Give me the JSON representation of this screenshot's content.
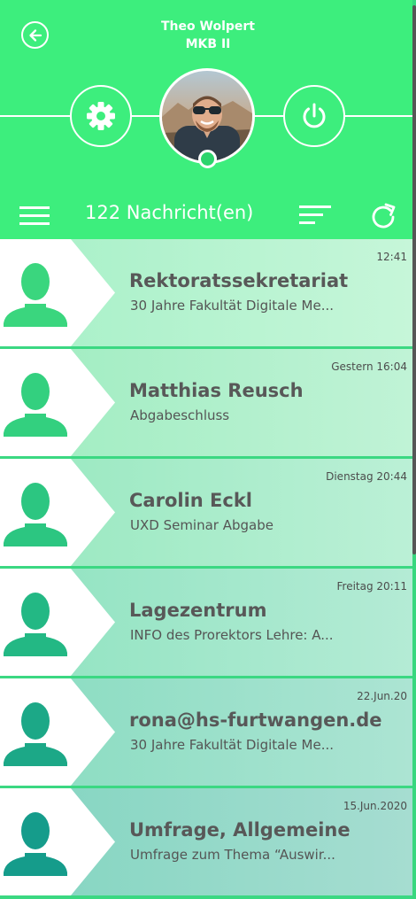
{
  "header": {
    "user_name": "Theo Wolpert",
    "user_group": "MKB II",
    "icons": {
      "back": "arrow-left-circle-icon",
      "settings": "gear-icon",
      "logout": "power-icon",
      "menu": "hamburger-menu-icon",
      "sort": "sort-lines-icon",
      "refresh": "refresh-icon"
    }
  },
  "toolbar": {
    "message_count": "122 Nachricht(en)"
  },
  "colors": {
    "header_bg": "#3dee7d",
    "text_dark": "#585858",
    "accent_start": "#3bd882",
    "accent_end": "#1a9e8c"
  },
  "messages": [
    {
      "time": "12:41",
      "sender": "Rektoratssekretariat",
      "subject": "30 Jahre Fakultät Digitale Me..."
    },
    {
      "time": "Gestern 16:04",
      "sender": "Matthias Reusch",
      "subject": "Abgabeschluss"
    },
    {
      "time": "Dienstag 20:44",
      "sender": "Carolin Eckl",
      "subject": "UXD Seminar Abgabe"
    },
    {
      "time": "Freitag 20:11",
      "sender": "Lagezentrum",
      "subject": "INFO des Prorektors Lehre: A..."
    },
    {
      "time": "22.Jun.20",
      "sender": "rona@hs-furtwangen.de",
      "subject": "30 Jahre Fakultät Digitale Me..."
    },
    {
      "time": "15.Jun.2020",
      "sender": "Umfrage, Allgemeine",
      "subject": "Umfrage zum Thema “Auswir..."
    }
  ]
}
